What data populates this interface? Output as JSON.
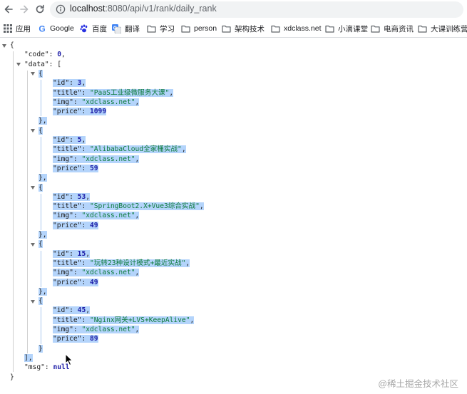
{
  "browser": {
    "url_host": "localhost",
    "url_path": ":8080/api/v1/rank/daily_rank"
  },
  "bookmarks": [
    {
      "label": "应用",
      "icon": "apps-grid-icon"
    },
    {
      "label": "Google",
      "icon": "google-icon"
    },
    {
      "label": "百度",
      "icon": "baidu-paw-icon"
    },
    {
      "label": "翻译",
      "icon": "translate-icon"
    },
    {
      "label": "学习",
      "icon": "folder-icon"
    },
    {
      "label": "person",
      "icon": "folder-icon"
    },
    {
      "label": "架构技术",
      "icon": "folder-icon"
    },
    {
      "label": "xdclass.net",
      "icon": "folder-icon"
    },
    {
      "label": "小滴课堂",
      "icon": "folder-icon"
    },
    {
      "label": "电商资讯",
      "icon": "folder-icon"
    },
    {
      "label": "大课训练营",
      "icon": "folder-icon"
    }
  ],
  "json": {
    "code": 0,
    "data": [
      {
        "id": 3,
        "title": "PaaS工业级微服务大课",
        "img": "xdclass.net",
        "price": 1099
      },
      {
        "id": 5,
        "title": "AlibabaCloud全家桶实战",
        "img": "xdclass.net",
        "price": 59
      },
      {
        "id": 53,
        "title": "SpringBoot2.X+Vue3综合实战",
        "img": "xdclass.net",
        "price": 49
      },
      {
        "id": 15,
        "title": "玩转23种设计模式+最近实战",
        "img": "xdclass.net",
        "price": 49
      },
      {
        "id": 45,
        "title": "Nginx网关+LVS+KeepAlive",
        "img": "xdclass.net",
        "price": 89
      }
    ],
    "msg": "null"
  },
  "watermark": "@稀土掘金技术社区",
  "colors": {
    "selection": "#b4d4fb",
    "string": "#0b7a3a",
    "number": "#1a1aa6"
  }
}
